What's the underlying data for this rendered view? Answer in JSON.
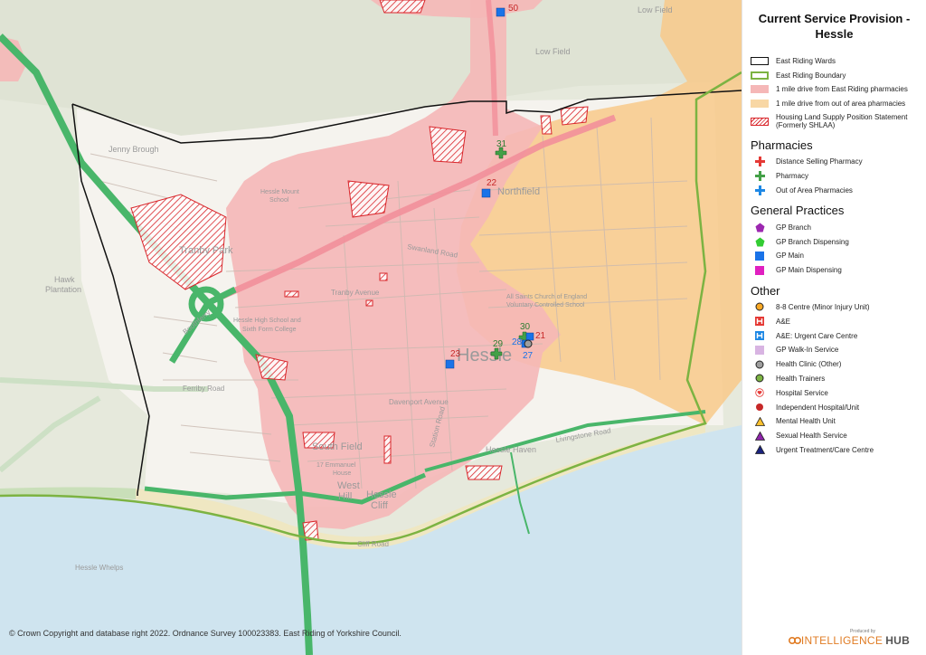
{
  "title_line1": "Current Service Provision -",
  "title_line2": "Hessle",
  "copyright": "© Crown Copyright and database right 2022. Ordnance Survey 100023383. East Riding of Yorkshire Council.",
  "brand": {
    "produced_by": "Produced by",
    "name_part1": "INTELLIGENCE",
    "name_part2": "HUB"
  },
  "legend": {
    "areas": [
      {
        "label": "East Riding Wards",
        "style": "outline-black"
      },
      {
        "label": "East Riding Boundary",
        "style": "outline-green"
      },
      {
        "label": "1 mile drive from East Riding pharmacies",
        "style": "fill-pink"
      },
      {
        "label": "1 mile drive from out of area pharmacies",
        "style": "fill-orange"
      },
      {
        "label": "Housing Land Supply Position Statement (Formerly SHLAA)",
        "style": "hatch-red"
      }
    ],
    "pharmacies_heading": "Pharmacies",
    "pharmacies": [
      {
        "label": "Distance Selling Pharmacy",
        "icon": "red-cross-icon"
      },
      {
        "label": "Pharmacy",
        "icon": "green-cross-icon"
      },
      {
        "label": "Out of Area Pharmacies",
        "icon": "blue-cross-icon"
      }
    ],
    "gp_heading": "General Practices",
    "gp": [
      {
        "label": "GP Branch",
        "icon": "purple-pentagon-icon"
      },
      {
        "label": "GP Branch Dispensing",
        "icon": "green-pentagon-icon"
      },
      {
        "label": "GP Main",
        "icon": "blue-square-icon"
      },
      {
        "label": "GP Main Dispensing",
        "icon": "magenta-square-icon"
      }
    ],
    "other_heading": "Other",
    "other": [
      {
        "label": "8-8 Centre (Minor Injury Unit)",
        "icon": "orange-circle-icon"
      },
      {
        "label": "A&E",
        "icon": "red-hospital-h-icon"
      },
      {
        "label": "A&E: Urgent Care Centre",
        "icon": "blue-hospital-h-icon"
      },
      {
        "label": "GP Walk-In Service",
        "icon": "lilac-square-icon"
      },
      {
        "label": "Health Clinic (Other)",
        "icon": "grey-circle-icon"
      },
      {
        "label": "Health Trainers",
        "icon": "olive-circle-icon"
      },
      {
        "label": "Hospital Service",
        "icon": "heart-circle-icon"
      },
      {
        "label": "Independent Hospital/Unit",
        "icon": "dark-red-circle-icon"
      },
      {
        "label": "Mental Health Unit",
        "icon": "yellow-triangle-icon"
      },
      {
        "label": "Sexual Health Service",
        "icon": "purple-triangle-icon"
      },
      {
        "label": "Urgent Treatment/Care Centre",
        "icon": "navy-triangle-icon"
      }
    ]
  },
  "place_labels": {
    "hessle": "Hessle",
    "northfield": "Northfield",
    "tranby_park": "Tranby Park",
    "jenny_brough": "Jenny Brough",
    "hawk_plantation_1": "Hawk",
    "hawk_plantation_2": "Plantation",
    "south_field": "South Field",
    "west_hill_1": "West",
    "west_hill_2": "Hill",
    "hessle_cliff_1": "Hessle",
    "hessle_cliff_2": "Cliff",
    "hessle_haven": "Hessle Haven",
    "hessle_whelps": "Hessle Whelps",
    "low_field": "Low Field",
    "low_field_ne": "Low Field",
    "ferriby_road": "Ferriby Road",
    "swanland_road": "Swanland Road",
    "tranby_avenue": "Tranby Avenue",
    "davenport_avenue": "Davenport Avenue",
    "livingstone_road": "Livingstone Road",
    "cliff_road": "Cliff Road",
    "station_road": "Station Road",
    "boothferry_road": "Boothferry",
    "high_school_1": "Hessle High School and",
    "high_school_2": "Sixth Form College",
    "mount_school_1": "Hessle Mount",
    "mount_school_2": "School",
    "emmanuel_1": "17 Emmanuel",
    "emmanuel_2": "House",
    "all_saints_1": "All Saints Church of England",
    "all_saints_2": "Voluntary Controlled School"
  },
  "sites": [
    {
      "number": "50",
      "type": "GP Main"
    },
    {
      "number": "31",
      "type": "Pharmacy"
    },
    {
      "number": "22",
      "type": "GP Main"
    },
    {
      "number": "23",
      "type": "GP Main"
    },
    {
      "number": "29",
      "type": "Pharmacy"
    },
    {
      "number": "30",
      "type": "Pharmacy"
    },
    {
      "number": "21",
      "type": "GP Main"
    },
    {
      "number": "28",
      "type": "GP Main"
    },
    {
      "number": "27",
      "type": "Health Clinic (Other)"
    }
  ],
  "colors": {
    "land": "#e6e9dc",
    "urban": "#f5f3ee",
    "water": "#cfe4ef",
    "beach": "#efe7c2",
    "pink_zone": "#f5b7b7",
    "orange_zone": "#f8c98a",
    "major_road": "#49b66a",
    "ward": "#111111",
    "er_boundary": "#7cb342",
    "hatch": "#d9262b"
  }
}
